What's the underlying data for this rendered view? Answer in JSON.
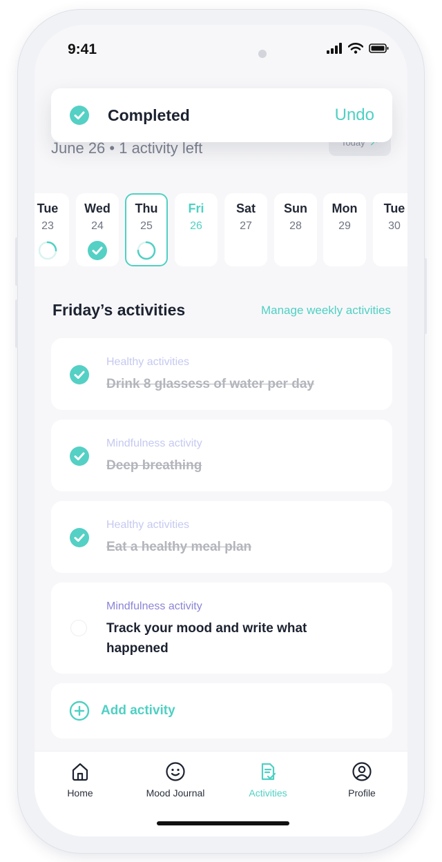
{
  "status_bar": {
    "time": "9:41"
  },
  "toast": {
    "message": "Completed",
    "undo_label": "Undo"
  },
  "header": {
    "subtitle": "June 26 • 1 activity left",
    "today_label": "Today"
  },
  "week": [
    {
      "day": "Tue",
      "date": "23",
      "state": "partial"
    },
    {
      "day": "Wed",
      "date": "24",
      "state": "done"
    },
    {
      "day": "Thu",
      "date": "25",
      "state": "partial-selected"
    },
    {
      "day": "Fri",
      "date": "26",
      "state": "current"
    },
    {
      "day": "Sat",
      "date": "27",
      "state": "none"
    },
    {
      "day": "Sun",
      "date": "28",
      "state": "none"
    },
    {
      "day": "Mon",
      "date": "29",
      "state": "none"
    },
    {
      "day": "Tue",
      "date": "30",
      "state": "none"
    }
  ],
  "section": {
    "title": "Friday’s activities",
    "link": "Manage weekly activities"
  },
  "activities": [
    {
      "category": "Healthy activities",
      "title": "Drink 8 glassess of water per day",
      "done": true
    },
    {
      "category": "Mindfulness activity",
      "title": "Deep breathing",
      "done": true
    },
    {
      "category": "Healthy activities",
      "title": "Eat a healthy meal plan",
      "done": true
    },
    {
      "category": "Mindfulness activity",
      "title": "Track your mood and write what happened",
      "done": false
    }
  ],
  "add_activity": {
    "label": "Add activity"
  },
  "tabs": [
    {
      "label": "Home",
      "icon": "home-icon",
      "active": false
    },
    {
      "label": "Mood Journal",
      "icon": "smiley-icon",
      "active": false
    },
    {
      "label": "Activities",
      "icon": "checklist-icon",
      "active": true
    },
    {
      "label": "Profile",
      "icon": "profile-icon",
      "active": false
    }
  ],
  "colors": {
    "accent": "#4fd0c3",
    "category": "#8a84d6",
    "text": "#1c2230",
    "muted": "#7c8190"
  }
}
